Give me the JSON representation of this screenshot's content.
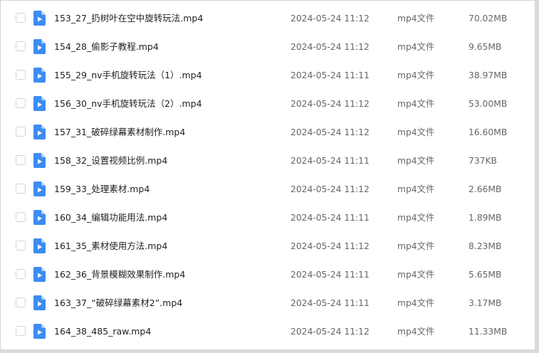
{
  "colors": {
    "file_icon_blue": "#3c8cf2",
    "file_icon_fold": "#a9cdfa",
    "checkbox_border": "#d0d4da"
  },
  "files": [
    {
      "name": "153_27_扔树叶在空中旋转玩法.mp4",
      "date": "2024-05-24 11:12",
      "type": "mp4文件",
      "size": "70.02MB",
      "icon": "video-file-icon"
    },
    {
      "name": "154_28_偷影子教程.mp4",
      "date": "2024-05-24 11:12",
      "type": "mp4文件",
      "size": "9.65MB",
      "icon": "video-file-icon"
    },
    {
      "name": "155_29_nv手机旋转玩法（1）.mp4",
      "date": "2024-05-24 11:11",
      "type": "mp4文件",
      "size": "38.97MB",
      "icon": "video-file-icon"
    },
    {
      "name": "156_30_nv手机旋转玩法（2）.mp4",
      "date": "2024-05-24 11:12",
      "type": "mp4文件",
      "size": "53.00MB",
      "icon": "video-file-icon"
    },
    {
      "name": "157_31_破碎绿幕素材制作.mp4",
      "date": "2024-05-24 11:12",
      "type": "mp4文件",
      "size": "16.60MB",
      "icon": "video-file-icon"
    },
    {
      "name": "158_32_设置视频比例.mp4",
      "date": "2024-05-24 11:11",
      "type": "mp4文件",
      "size": "737KB",
      "icon": "video-file-icon"
    },
    {
      "name": "159_33_处理素材.mp4",
      "date": "2024-05-24 11:12",
      "type": "mp4文件",
      "size": "2.66MB",
      "icon": "video-file-icon"
    },
    {
      "name": "160_34_编辑功能用法.mp4",
      "date": "2024-05-24 11:11",
      "type": "mp4文件",
      "size": "1.89MB",
      "icon": "video-file-icon"
    },
    {
      "name": "161_35_素材使用方法.mp4",
      "date": "2024-05-24 11:12",
      "type": "mp4文件",
      "size": "8.23MB",
      "icon": "video-file-icon"
    },
    {
      "name": "162_36_背景模糊效果制作.mp4",
      "date": "2024-05-24 11:11",
      "type": "mp4文件",
      "size": "5.65MB",
      "icon": "video-file-icon"
    },
    {
      "name": "163_37_“破碎绿幕素材2”.mp4",
      "date": "2024-05-24 11:11",
      "type": "mp4文件",
      "size": "3.17MB",
      "icon": "video-file-icon"
    },
    {
      "name": "164_38_485_raw.mp4",
      "date": "2024-05-24 11:12",
      "type": "mp4文件",
      "size": "11.33MB",
      "icon": "video-file-icon"
    }
  ]
}
